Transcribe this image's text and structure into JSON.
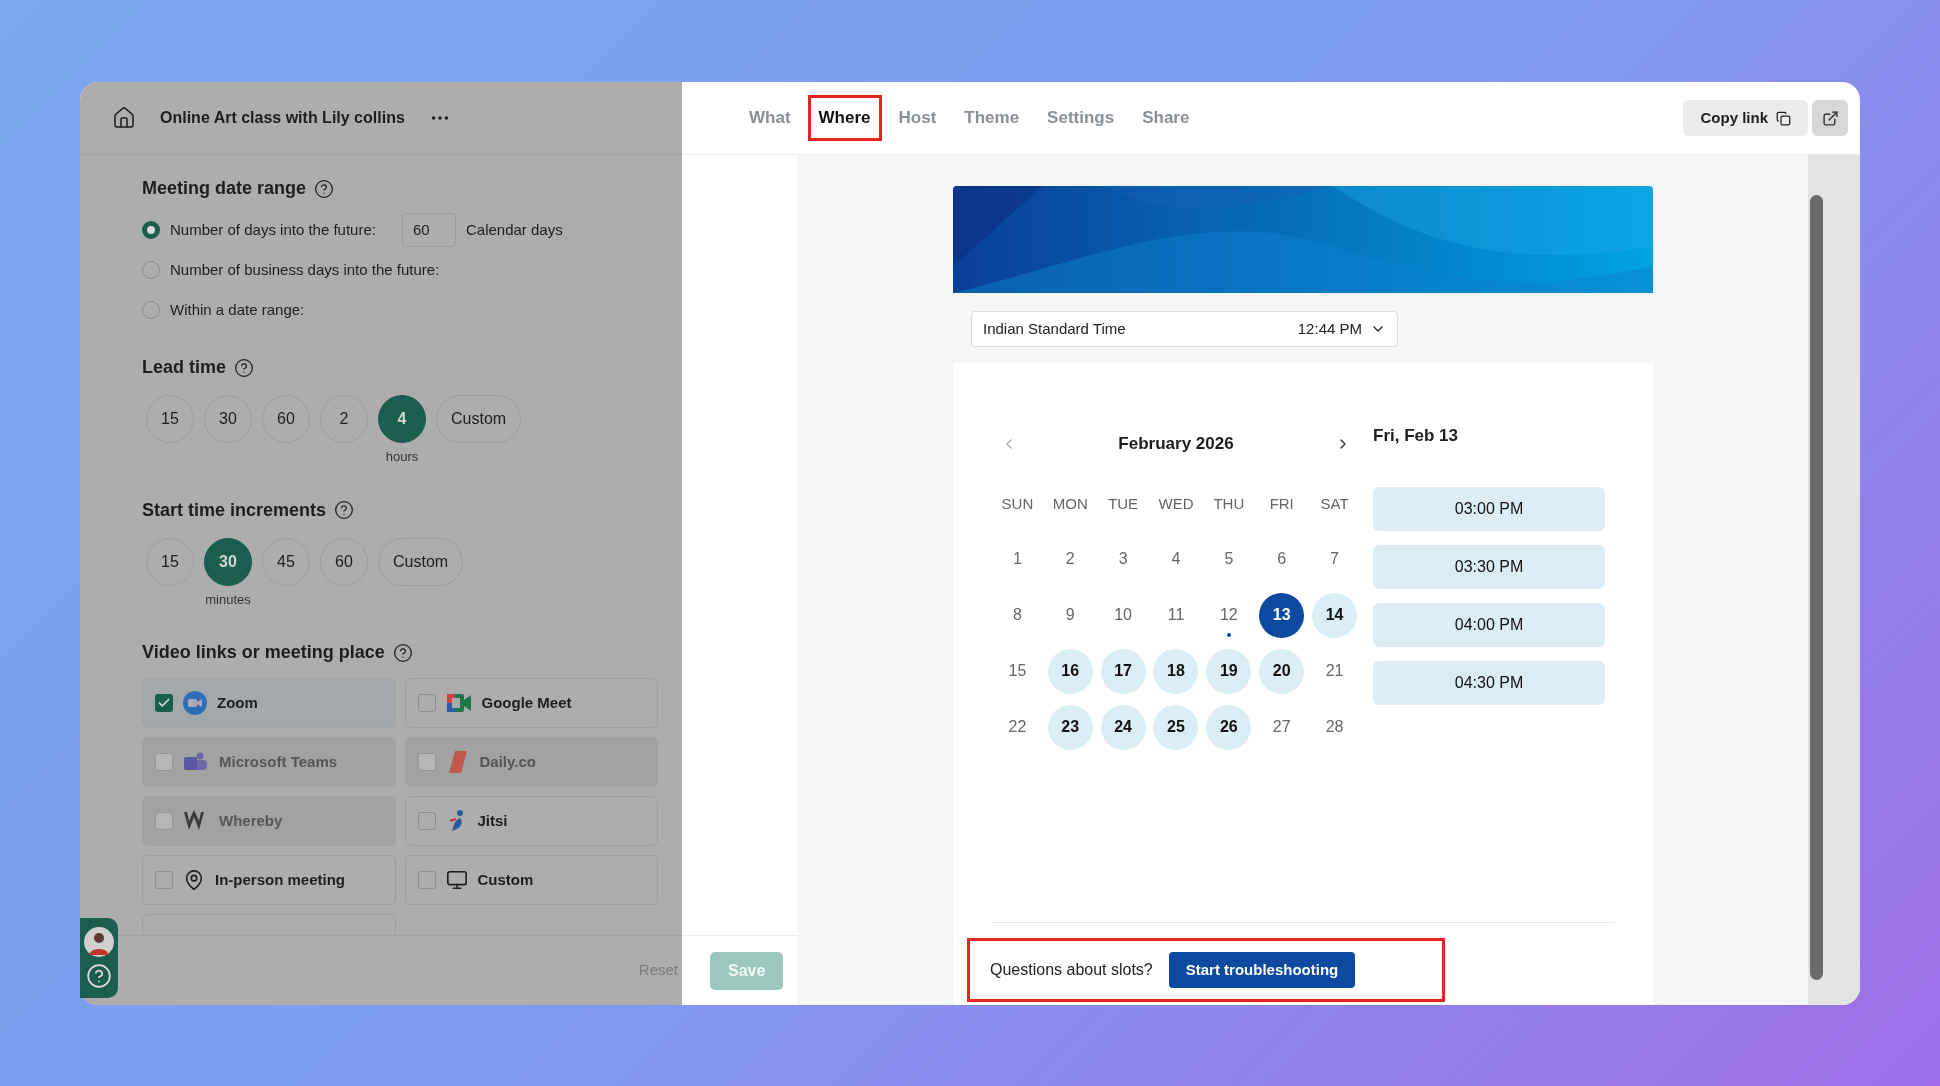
{
  "event": {
    "title": "Online Art class with Lily collins"
  },
  "tabs": [
    {
      "label": "What",
      "selected": false,
      "annotated": false
    },
    {
      "label": "Where",
      "selected": true,
      "annotated": true
    },
    {
      "label": "Host",
      "selected": false,
      "annotated": false
    },
    {
      "label": "Theme",
      "selected": false,
      "annotated": false
    },
    {
      "label": "Settings",
      "selected": false,
      "annotated": false
    },
    {
      "label": "Share",
      "selected": false,
      "annotated": false
    }
  ],
  "copy_link": "Copy link",
  "date_range": {
    "title": "Meeting date range",
    "options": [
      {
        "label": "Number of days into the future:",
        "selected": true,
        "value": "60",
        "suffix": "Calendar days"
      },
      {
        "label": "Number of business days into the future:",
        "selected": false
      },
      {
        "label": "Within a date range:",
        "selected": false
      }
    ]
  },
  "lead_time": {
    "title": "Lead time",
    "unit": "hours",
    "options": [
      {
        "label": "15",
        "selected": false
      },
      {
        "label": "30",
        "selected": false
      },
      {
        "label": "60",
        "selected": false
      },
      {
        "label": "2",
        "selected": false
      },
      {
        "label": "4",
        "selected": true
      },
      {
        "label": "Custom",
        "selected": false
      }
    ]
  },
  "increments": {
    "title": "Start time increments",
    "unit": "minutes",
    "options": [
      {
        "label": "15",
        "selected": false
      },
      {
        "label": "30",
        "selected": true
      },
      {
        "label": "45",
        "selected": false
      },
      {
        "label": "60",
        "selected": false
      },
      {
        "label": "Custom",
        "selected": false
      }
    ]
  },
  "places": {
    "title": "Video links or meeting place",
    "options": [
      {
        "label": "Zoom",
        "checked": true,
        "disabled": false
      },
      {
        "label": "Google Meet",
        "checked": false,
        "disabled": false
      },
      {
        "label": "Microsoft Teams",
        "checked": false,
        "disabled": true
      },
      {
        "label": "Daily.co",
        "checked": false,
        "disabled": true
      },
      {
        "label": "Whereby",
        "checked": false,
        "disabled": true
      },
      {
        "label": "Jitsi",
        "checked": false,
        "disabled": false
      },
      {
        "label": "In-person meeting",
        "checked": false,
        "disabled": false
      },
      {
        "label": "Custom",
        "checked": false,
        "disabled": false
      }
    ]
  },
  "footer": {
    "reset": "Reset",
    "save": "Save"
  },
  "preview": {
    "timezone": "Indian Standard Time",
    "time": "12:44 PM",
    "month": "February 2026",
    "selected_date": "Fri, Feb 13",
    "weekdays": [
      "SUN",
      "MON",
      "TUE",
      "WED",
      "THU",
      "FRI",
      "SAT"
    ],
    "days": [
      {
        "label": "1",
        "available": false,
        "selected": false,
        "today": false
      },
      {
        "label": "2",
        "available": false,
        "selected": false,
        "today": false
      },
      {
        "label": "3",
        "available": false,
        "selected": false,
        "today": false
      },
      {
        "label": "4",
        "available": false,
        "selected": false,
        "today": false
      },
      {
        "label": "5",
        "available": false,
        "selected": false,
        "today": false
      },
      {
        "label": "6",
        "available": false,
        "selected": false,
        "today": false
      },
      {
        "label": "7",
        "available": false,
        "selected": false,
        "today": false
      },
      {
        "label": "8",
        "available": false,
        "selected": false,
        "today": false
      },
      {
        "label": "9",
        "available": false,
        "selected": false,
        "today": false
      },
      {
        "label": "10",
        "available": false,
        "selected": false,
        "today": false
      },
      {
        "label": "11",
        "available": false,
        "selected": false,
        "today": false
      },
      {
        "label": "12",
        "available": false,
        "selected": false,
        "today": true
      },
      {
        "label": "13",
        "available": true,
        "selected": true,
        "today": false
      },
      {
        "label": "14",
        "available": true,
        "selected": false,
        "today": false
      },
      {
        "label": "15",
        "available": false,
        "selected": false,
        "today": false
      },
      {
        "label": "16",
        "available": true,
        "selected": false,
        "today": false
      },
      {
        "label": "17",
        "available": true,
        "selected": false,
        "today": false
      },
      {
        "label": "18",
        "available": true,
        "selected": false,
        "today": false
      },
      {
        "label": "19",
        "available": true,
        "selected": false,
        "today": false
      },
      {
        "label": "20",
        "available": true,
        "selected": false,
        "today": false
      },
      {
        "label": "21",
        "available": false,
        "selected": false,
        "today": false
      },
      {
        "label": "22",
        "available": false,
        "selected": false,
        "today": false
      },
      {
        "label": "23",
        "available": true,
        "selected": false,
        "today": false
      },
      {
        "label": "24",
        "available": true,
        "selected": false,
        "today": false
      },
      {
        "label": "25",
        "available": true,
        "selected": false,
        "today": false
      },
      {
        "label": "26",
        "available": true,
        "selected": false,
        "today": false
      },
      {
        "label": "27",
        "available": false,
        "selected": false,
        "today": false
      },
      {
        "label": "28",
        "available": false,
        "selected": false,
        "today": false
      }
    ],
    "slots": [
      "03:00 PM",
      "03:30 PM",
      "04:00 PM",
      "04:30 PM"
    ],
    "troubleshoot": {
      "question": "Questions about slots?",
      "button": "Start troubleshooting",
      "annotated": true
    }
  }
}
